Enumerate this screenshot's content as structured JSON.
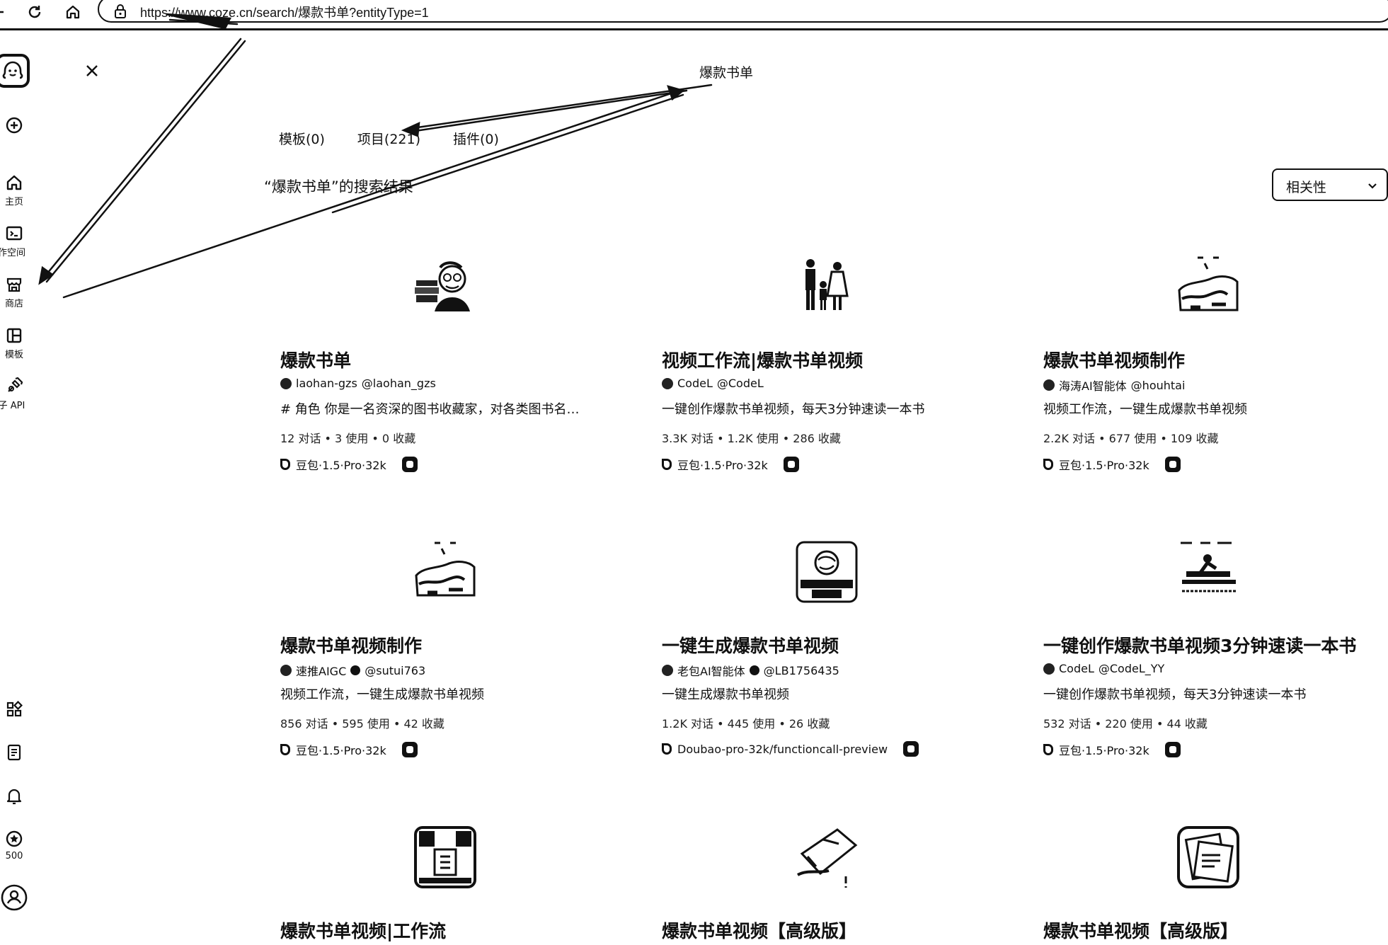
{
  "browser": {
    "url": "https://www.coze.cn/search/爆款书单?entityType=1"
  },
  "sidebar": {
    "items": [
      {
        "label": "主页"
      },
      {
        "label": "工作空间"
      },
      {
        "label": "商店"
      },
      {
        "label": "模板"
      },
      {
        "label": "扣子 API"
      }
    ],
    "points": "500"
  },
  "search": {
    "query": "爆款书单",
    "tabs": [
      {
        "label": "模板(0)"
      },
      {
        "label": "项目(221)"
      },
      {
        "label": "插件(0)"
      }
    ],
    "results_heading": "“爆款书单”的搜索结果",
    "sort_label": "相关性"
  },
  "cards": [
    {
      "title": "爆款书单",
      "author": "laohan-gzs",
      "handle": "@laohan_gzs",
      "desc": "# 角色 你是一名资深的图书收藏家，对各类图书名…",
      "stats": "12 对话 • 3 使用 • 0 收藏",
      "model": "豆包·1.5·Pro·32k"
    },
    {
      "title": "视频工作流|爆款书单视频",
      "author": "CodeL",
      "handle": "@CodeL",
      "desc": "一键创作爆款书单视频，每天3分钟速读一本书",
      "stats": "3.3K 对话 • 1.2K 使用 • 286 收藏",
      "model": "豆包·1.5·Pro·32k"
    },
    {
      "title": "爆款书单视频制作",
      "author": "海涛AI智能体",
      "handle": "@houhtai",
      "desc": "视频工作流，一键生成爆款书单视频",
      "stats": "2.2K 对话 • 677 使用 • 109 收藏",
      "model": "豆包·1.5·Pro·32k"
    },
    {
      "title": "爆款书单视频制作",
      "author": "速推AIGC",
      "handle": "@sutui763",
      "desc": "视频工作流，一键生成爆款书单视频",
      "stats": "856 对话 • 595 使用 • 42 收藏",
      "model": "豆包·1.5·Pro·32k"
    },
    {
      "title": "一键生成爆款书单视频",
      "author": "老包AI智能体",
      "handle": "@LB1756435",
      "desc": "一键生成爆款书单视频",
      "stats": "1.2K 对话 • 445 使用 • 26 收藏",
      "model": "Doubao-pro-32k/functioncall-preview"
    },
    {
      "title": "一键创作爆款书单视频3分钟速读一本书",
      "author": "CodeL",
      "handle": "@CodeL_YY",
      "desc": "一键创作爆款书单视频，每天3分钟速读一本书",
      "stats": "532 对话 • 220 使用 • 44 收藏",
      "model": "豆包·1.5·Pro·32k"
    },
    {
      "title": "爆款书单视频|工作流"
    },
    {
      "title": "爆款书单视频【高级版】"
    },
    {
      "title": "爆款书单视频【高级版】"
    }
  ]
}
